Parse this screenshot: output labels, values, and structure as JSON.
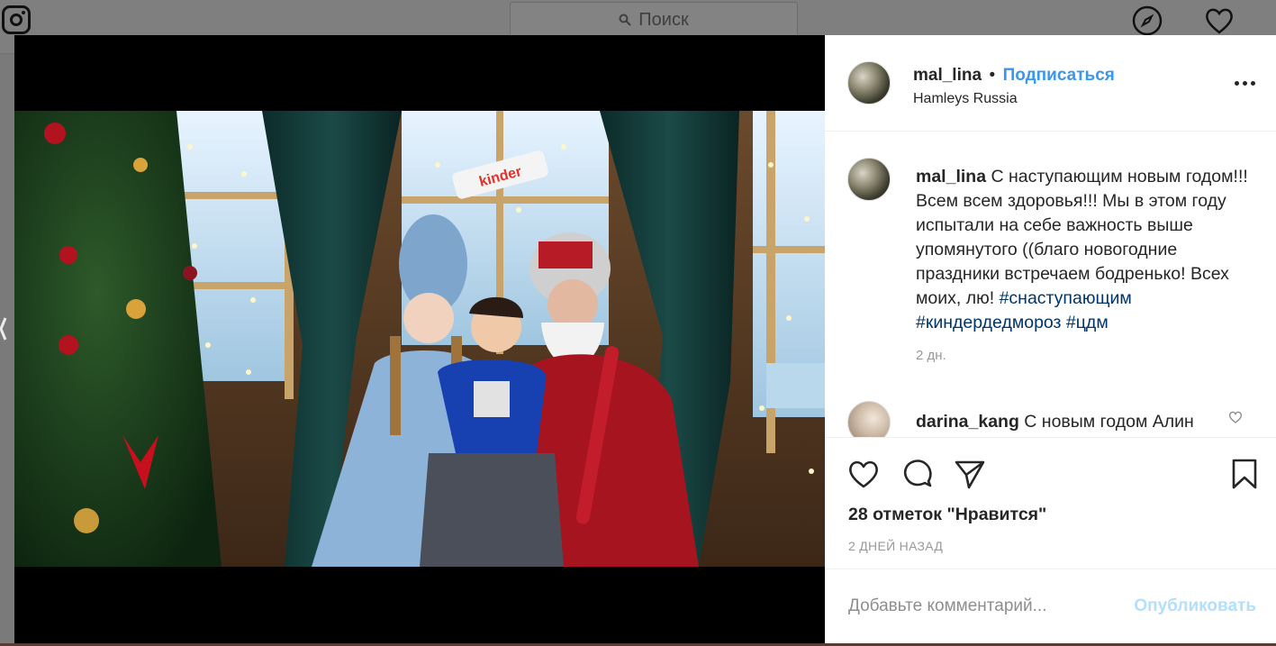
{
  "topbar": {
    "search_placeholder": "Поиск",
    "icons": [
      "instagram-logo-icon",
      "search-icon",
      "compass-icon",
      "heart-icon"
    ]
  },
  "post": {
    "header": {
      "username": "mal_lina",
      "separator": "•",
      "follow_label": "Подписаться",
      "location": "Hamleys Russia"
    },
    "caption": {
      "username": "mal_lina",
      "text": " С наступающим новым годом!!! Всем всем здоровья!!! Мы в этом году испытали на себе важность выше упомянутого ((благо новогодние праздники встречаем бодренько! Всех моих, лю! ",
      "hashtags": [
        "#снаступающим",
        "#киндердедмороз",
        "#цдм"
      ],
      "time": "2 дн."
    },
    "comments": [
      {
        "username": "darina_kang",
        "text": " С новым годом Алин"
      }
    ],
    "likes_text": "28 отметок \"Нравится\"",
    "post_time": "2 ДНЕЙ НАЗАД",
    "add_comment_placeholder": "Добавьте комментарий...",
    "publish_label": "Опубликовать"
  },
  "colors": {
    "link_blue": "#3897f0",
    "hashtag_blue": "#003569",
    "publish_disabled": "#b2dffc",
    "overlay": "#7a7a7a"
  }
}
